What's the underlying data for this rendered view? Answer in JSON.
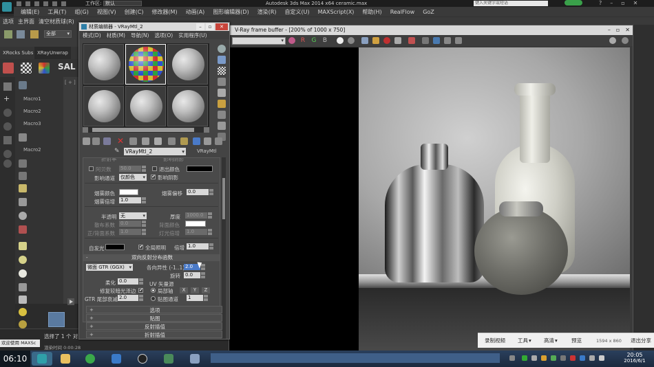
{
  "app": {
    "workspace_label": "工作区:",
    "workspace_value": "默认",
    "title": "Autodesk 3ds Max 2014 x64    ceramic.max",
    "search_placeholder": "键入关键字或短语"
  },
  "menubar": [
    "编辑(E)",
    "工具(T)",
    "组(G)",
    "视图(V)",
    "创建(C)",
    "修改器(M)",
    "动画(A)",
    "图形编辑器(D)",
    "渲染(R)",
    "自定义(U)",
    "MAXScript(X)",
    "帮助(H)",
    "RealFlow",
    "GoZ"
  ],
  "toolbar1": [
    "选项",
    "主界面",
    "清空材质球(R)"
  ],
  "toolbar2": {
    "filter": "全部"
  },
  "ribbon_tabs": [
    "XRocks Subs",
    "XRayUnwrap"
  ],
  "sal_label": "SAL",
  "viewport_label": "[ + ]",
  "macros": [
    "Macro1",
    "Macro2",
    "Macro3",
    "Macro2"
  ],
  "status": {
    "welcome": "欢迎使用 MAXSc",
    "selection": "选择了 1 个 对",
    "render_time": "渲染时间 0:00:28"
  },
  "material_editor": {
    "title": "材质编辑器 - VRayMtl_2",
    "menu": [
      "模式(D)",
      "材质(M)",
      "导航(N)",
      "选项(O)",
      "实用程序(U)"
    ],
    "material_name": "VRayMtl_2",
    "material_type": "VRayMtl",
    "params": {
      "top_cut_left": "折射率",
      "top_cut_right": "影响阴影",
      "exit_color_chk": "退出颜色",
      "aperture": "阿贝数",
      "aperture_val": "50.0",
      "affect_shadows": "影响阴影",
      "affect_channels": "影响通道",
      "affect_channels_val": "仅颜色",
      "fog_color": "烟雾颜色",
      "fog_bias": "烟雾偏移",
      "fog_bias_val": "0.0",
      "fog_mult": "烟雾倍增",
      "fog_mult_val": "1.0",
      "translucency": "半透明",
      "translucency_val": "无",
      "thickness": "厚度",
      "thickness_val": "1000.0",
      "scatter_coeff": "散布系数",
      "scatter_coeff_val": "0.0",
      "back_color": "背面颜色",
      "fwd_back": "正/背面系数",
      "fwd_back_val": "1.0",
      "light_mult": "灯光倍增",
      "light_mult_val": "1.0",
      "self_illum": "自发光",
      "gi_chk": "全局照明",
      "self_mult": "倍增",
      "self_mult_val": "1.0",
      "brdf_header": "双向反射分布函数",
      "brdf_type": "微面 GTR (GGX)",
      "anisotropy": "各向异性 (-1..1)",
      "anisotropy_val": "2.0",
      "rotation": "旋转",
      "rotation_val": "0.0",
      "soften": "柔化",
      "soften_val": "0.0",
      "fix_dark": "修复较暗光泽边",
      "uv_vectors": "UV 矢量源",
      "local_axis": "局部轴",
      "axis_x": "X",
      "axis_y": "Y",
      "axis_z": "Z",
      "gtr_tail": "GTR 尾部衰减",
      "gtr_tail_val": "2.0",
      "map_channel": "贴图通道",
      "map_channel_val": "1"
    },
    "rollups": [
      "选项",
      "贴图",
      "反射插值",
      "折射插值"
    ]
  },
  "frame_buffer": {
    "title": "V-Ray frame buffer - [200% of 1000 x 750]",
    "toolbar_letters": [
      "R",
      "G",
      "B"
    ]
  },
  "recorder_bar": {
    "record": "录制视频",
    "tools": "工具",
    "quality": "高清",
    "preview": "预览",
    "resolution": "1594 x 860",
    "exit": "退出分享"
  },
  "taskbar": {
    "time_left": "06:10",
    "clock_time": "20:05",
    "clock_date": "2016/6/1"
  }
}
